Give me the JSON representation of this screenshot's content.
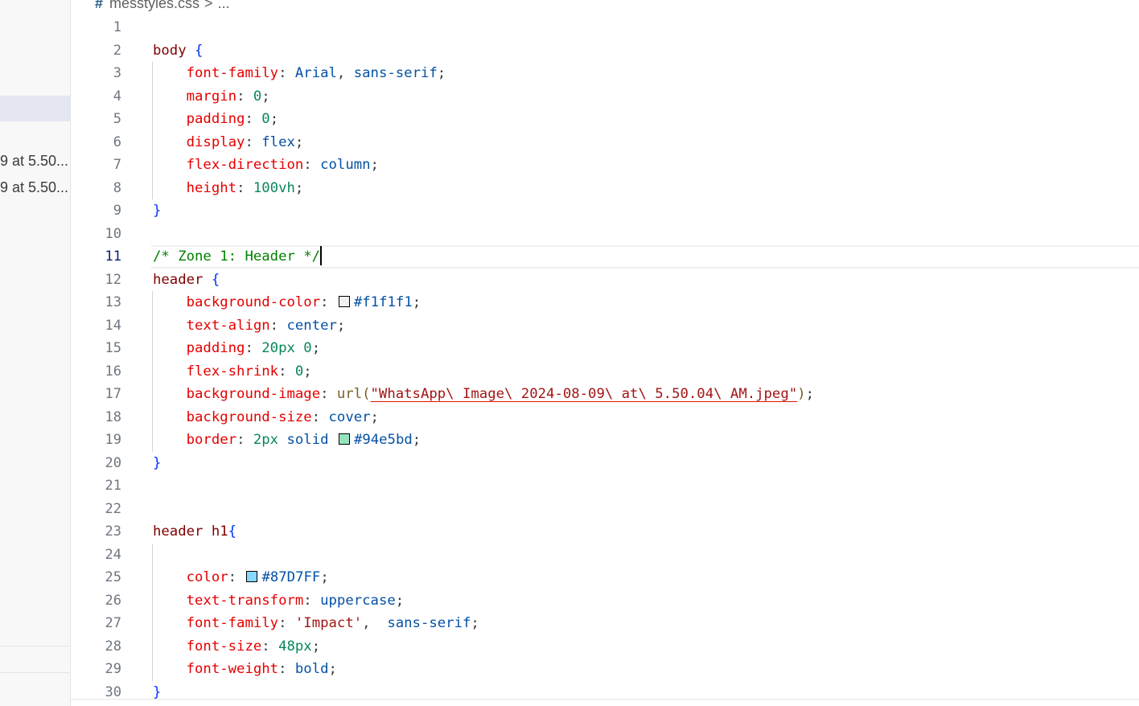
{
  "breadcrumb": {
    "icon": "#",
    "file": "messtyles.css",
    "sep": ">",
    "more": "..."
  },
  "sidebar": {
    "files": [
      "9 at 5.50...",
      "9 at 5.50..."
    ]
  },
  "colors": {
    "selector": "#800000",
    "brace": "#0431fa",
    "property": "#e50000",
    "value": "#0451a5",
    "number": "#098658",
    "comment": "#008000",
    "function": "#795e26",
    "string": "#a31515"
  },
  "editor": {
    "active_line": 11,
    "lines": [
      {
        "n": "1",
        "tokens": []
      },
      {
        "n": "2",
        "tokens": [
          [
            "sel",
            "body "
          ],
          [
            "brace",
            "{"
          ]
        ]
      },
      {
        "n": "3",
        "tokens": [
          [
            "ind",
            "    "
          ],
          [
            "prop",
            "font-family"
          ],
          [
            "punc",
            ": "
          ],
          [
            "val",
            "Arial"
          ],
          [
            "punc",
            ", "
          ],
          [
            "val",
            "sans-serif"
          ],
          [
            "punc",
            ";"
          ]
        ]
      },
      {
        "n": "4",
        "tokens": [
          [
            "ind",
            "    "
          ],
          [
            "prop",
            "margin"
          ],
          [
            "punc",
            ": "
          ],
          [
            "num",
            "0"
          ],
          [
            "punc",
            ";"
          ]
        ]
      },
      {
        "n": "5",
        "tokens": [
          [
            "ind",
            "    "
          ],
          [
            "prop",
            "padding"
          ],
          [
            "punc",
            ": "
          ],
          [
            "num",
            "0"
          ],
          [
            "punc",
            ";"
          ]
        ]
      },
      {
        "n": "6",
        "tokens": [
          [
            "ind",
            "    "
          ],
          [
            "prop",
            "display"
          ],
          [
            "punc",
            ": "
          ],
          [
            "val",
            "flex"
          ],
          [
            "punc",
            ";"
          ]
        ]
      },
      {
        "n": "7",
        "tokens": [
          [
            "ind",
            "    "
          ],
          [
            "prop",
            "flex-direction"
          ],
          [
            "punc",
            ": "
          ],
          [
            "val",
            "column"
          ],
          [
            "punc",
            ";"
          ]
        ]
      },
      {
        "n": "8",
        "tokens": [
          [
            "ind",
            "    "
          ],
          [
            "prop",
            "height"
          ],
          [
            "punc",
            ": "
          ],
          [
            "num",
            "100vh"
          ],
          [
            "punc",
            ";"
          ]
        ]
      },
      {
        "n": "9",
        "tokens": [
          [
            "brace",
            "}"
          ]
        ]
      },
      {
        "n": "10",
        "tokens": []
      },
      {
        "n": "11",
        "tokens": [
          [
            "com",
            "/* Zone 1: Header */"
          ],
          [
            "cursor",
            ""
          ]
        ]
      },
      {
        "n": "12",
        "tokens": [
          [
            "sel",
            "header "
          ],
          [
            "brace",
            "{"
          ]
        ]
      },
      {
        "n": "13",
        "tokens": [
          [
            "ind",
            "    "
          ],
          [
            "prop",
            "background-color"
          ],
          [
            "punc",
            ": "
          ],
          [
            "swatch",
            "#f1f1f1"
          ],
          [
            "val",
            "#f1f1f1"
          ],
          [
            "punc",
            ";"
          ]
        ]
      },
      {
        "n": "14",
        "tokens": [
          [
            "ind",
            "    "
          ],
          [
            "prop",
            "text-align"
          ],
          [
            "punc",
            ": "
          ],
          [
            "val",
            "center"
          ],
          [
            "punc",
            ";"
          ]
        ]
      },
      {
        "n": "15",
        "tokens": [
          [
            "ind",
            "    "
          ],
          [
            "prop",
            "padding"
          ],
          [
            "punc",
            ": "
          ],
          [
            "num",
            "20px 0"
          ],
          [
            "punc",
            ";"
          ]
        ]
      },
      {
        "n": "16",
        "tokens": [
          [
            "ind",
            "    "
          ],
          [
            "prop",
            "flex-shrink"
          ],
          [
            "punc",
            ": "
          ],
          [
            "num",
            "0"
          ],
          [
            "punc",
            ";"
          ]
        ]
      },
      {
        "n": "17",
        "tokens": [
          [
            "ind",
            "    "
          ],
          [
            "prop",
            "background-image"
          ],
          [
            "punc",
            ": "
          ],
          [
            "fn",
            "url("
          ],
          [
            "err",
            "\"WhatsApp\\ Image\\ 2024-08-09\\ at\\ 5.50.04\\ AM.jpeg\""
          ],
          [
            "fn",
            ")"
          ],
          [
            "punc",
            ";"
          ]
        ]
      },
      {
        "n": "18",
        "tokens": [
          [
            "ind",
            "    "
          ],
          [
            "prop",
            "background-size"
          ],
          [
            "punc",
            ": "
          ],
          [
            "val",
            "cover"
          ],
          [
            "punc",
            ";"
          ]
        ]
      },
      {
        "n": "19",
        "tokens": [
          [
            "ind",
            "    "
          ],
          [
            "prop",
            "border"
          ],
          [
            "punc",
            ": "
          ],
          [
            "num",
            "2px "
          ],
          [
            "val",
            "solid "
          ],
          [
            "swatch",
            "#94e5bd"
          ],
          [
            "val",
            "#94e5bd"
          ],
          [
            "punc",
            ";"
          ]
        ]
      },
      {
        "n": "20",
        "tokens": [
          [
            "brace",
            "}"
          ]
        ]
      },
      {
        "n": "21",
        "tokens": []
      },
      {
        "n": "22",
        "tokens": []
      },
      {
        "n": "23",
        "tokens": [
          [
            "sel",
            "header h1"
          ],
          [
            "brace",
            "{"
          ]
        ]
      },
      {
        "n": "24",
        "tokens": []
      },
      {
        "n": "25",
        "tokens": [
          [
            "ind",
            "    "
          ],
          [
            "prop",
            "color"
          ],
          [
            "punc",
            ": "
          ],
          [
            "swatch",
            "#87D7FF"
          ],
          [
            "val",
            "#87D7FF"
          ],
          [
            "punc",
            ";"
          ]
        ]
      },
      {
        "n": "26",
        "tokens": [
          [
            "ind",
            "    "
          ],
          [
            "prop",
            "text-transform"
          ],
          [
            "punc",
            ": "
          ],
          [
            "val",
            "uppercase"
          ],
          [
            "punc",
            ";"
          ]
        ]
      },
      {
        "n": "27",
        "tokens": [
          [
            "ind",
            "    "
          ],
          [
            "prop",
            "font-family"
          ],
          [
            "punc",
            ": "
          ],
          [
            "str",
            "'Impact'"
          ],
          [
            "punc",
            ",  "
          ],
          [
            "val",
            "sans-serif"
          ],
          [
            "punc",
            ";"
          ]
        ]
      },
      {
        "n": "28",
        "tokens": [
          [
            "ind",
            "    "
          ],
          [
            "prop",
            "font-size"
          ],
          [
            "punc",
            ": "
          ],
          [
            "num",
            "48px"
          ],
          [
            "punc",
            ";"
          ]
        ]
      },
      {
        "n": "29",
        "tokens": [
          [
            "ind",
            "    "
          ],
          [
            "prop",
            "font-weight"
          ],
          [
            "punc",
            ": "
          ],
          [
            "val",
            "bold"
          ],
          [
            "punc",
            ";"
          ]
        ]
      },
      {
        "n": "30",
        "tokens": [
          [
            "brace",
            "}"
          ]
        ]
      }
    ]
  }
}
